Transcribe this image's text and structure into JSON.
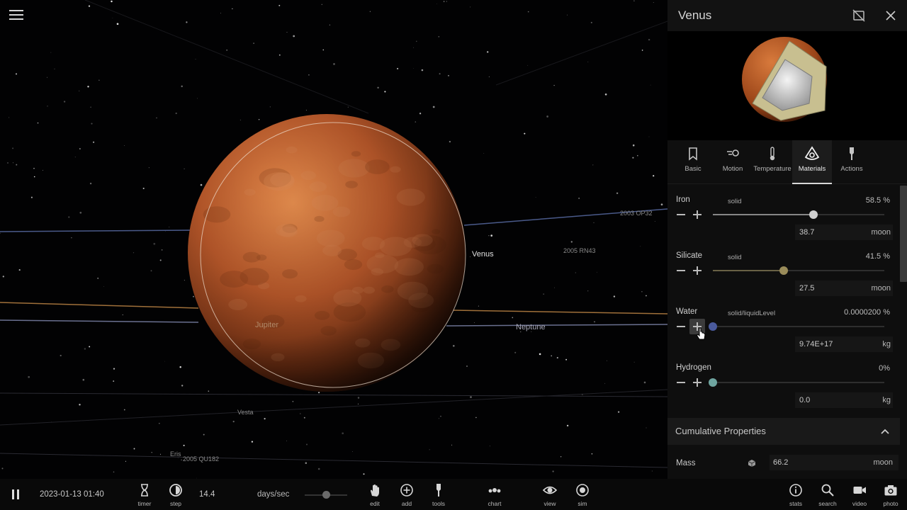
{
  "selected_body": {
    "name": "Venus"
  },
  "space_labels": {
    "venus": "Venus",
    "jupiter": "Jupiter",
    "neptune": "Neptune",
    "vesta": "Vesta",
    "eris": "Eris",
    "obj1": "2003 OP32",
    "obj2": "2005 RN43",
    "obj3": "2005 QU182"
  },
  "tabs": [
    {
      "label": "Basic",
      "icon": "bookmark-icon"
    },
    {
      "label": "Motion",
      "icon": "motion-icon"
    },
    {
      "label": "Temperature",
      "icon": "thermometer-icon"
    },
    {
      "label": "Materials",
      "icon": "materials-icon",
      "active": true
    },
    {
      "label": "Actions",
      "icon": "actions-icon"
    }
  ],
  "materials": [
    {
      "name": "Iron",
      "state": "solid",
      "percent": "58.5 %",
      "fraction": 0.585,
      "value": "38.7",
      "unit": "moon",
      "color": "#cfcfcf"
    },
    {
      "name": "Silicate",
      "state": "solid",
      "percent": "41.5 %",
      "fraction": 0.415,
      "value": "27.5",
      "unit": "moon",
      "color": "#9a8c5a"
    },
    {
      "name": "Water",
      "state": "solid/liquidLevel",
      "percent": "0.0000200 %",
      "fraction": 0.0,
      "value": "9.74E+17",
      "unit": "kg",
      "color": "#4a5a9c"
    },
    {
      "name": "Hydrogen",
      "state": "",
      "percent": "0%",
      "fraction": 0.0,
      "value": "0.0",
      "unit": "kg",
      "color": "#6fa5a0"
    }
  ],
  "cumulative": {
    "title": "Cumulative Properties",
    "mass": {
      "label": "Mass",
      "value": "66.2",
      "unit": "moon"
    }
  },
  "toolbar": {
    "date": "2023-01-13 01:40",
    "rate": "14.4",
    "rate_unit": "days/sec",
    "speed_fraction": 0.5,
    "left_items": [
      {
        "label": "timer",
        "icon": "hourglass-icon"
      },
      {
        "label": "step",
        "icon": "step-icon"
      }
    ],
    "center_items": [
      {
        "label": "edit",
        "icon": "hand-icon"
      },
      {
        "label": "add",
        "icon": "add-icon"
      },
      {
        "label": "tools",
        "icon": "tools-icon"
      },
      {
        "label": "chart",
        "icon": "chart-icon"
      },
      {
        "label": "view",
        "icon": "eye-icon"
      },
      {
        "label": "sim",
        "icon": "sim-icon"
      }
    ],
    "right_items": [
      {
        "label": "stats",
        "icon": "info-icon"
      },
      {
        "label": "search",
        "icon": "search-icon"
      },
      {
        "label": "video",
        "icon": "video-icon"
      },
      {
        "label": "photo",
        "icon": "camera-icon"
      }
    ]
  },
  "colors": {
    "venus_surface": "#b8582a",
    "jupiter_orbit": "#c08850",
    "neptune_orbit": "#8090b8"
  }
}
